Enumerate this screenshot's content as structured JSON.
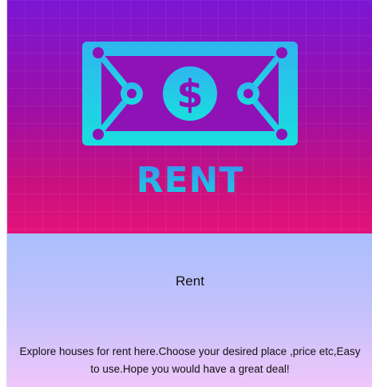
{
  "card": {
    "image": {
      "banner_text": "RENT",
      "icon": "banknote-dollar-icon"
    },
    "title": "Rent",
    "description": "Explore houses for rent here.Choose your desired place ,price etc,Easy to use.Hope you would have a great deal!"
  },
  "colors": {
    "hero_top": "#7a16d4",
    "hero_bottom": "#e3127a",
    "icon_cyan": "#19d8d8",
    "text_blue": "#3d8cf0",
    "body_top": "#a9bffc",
    "body_bottom": "#f0c7fb"
  }
}
